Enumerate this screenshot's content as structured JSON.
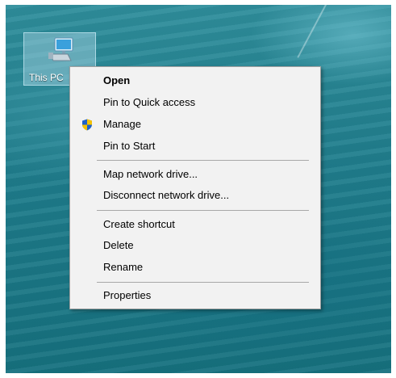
{
  "desktop": {
    "icon": {
      "label": "This PC",
      "icon": "computer-icon"
    }
  },
  "context_menu": {
    "items": [
      {
        "label": "Open",
        "bold": true
      },
      {
        "label": "Pin to Quick access"
      },
      {
        "label": "Manage",
        "icon": "uac-shield-icon"
      },
      {
        "label": "Pin to Start"
      },
      {
        "label": "Map network drive..."
      },
      {
        "label": "Disconnect network drive..."
      },
      {
        "label": "Create shortcut"
      },
      {
        "label": "Delete"
      },
      {
        "label": "Rename"
      },
      {
        "label": "Properties"
      }
    ]
  }
}
